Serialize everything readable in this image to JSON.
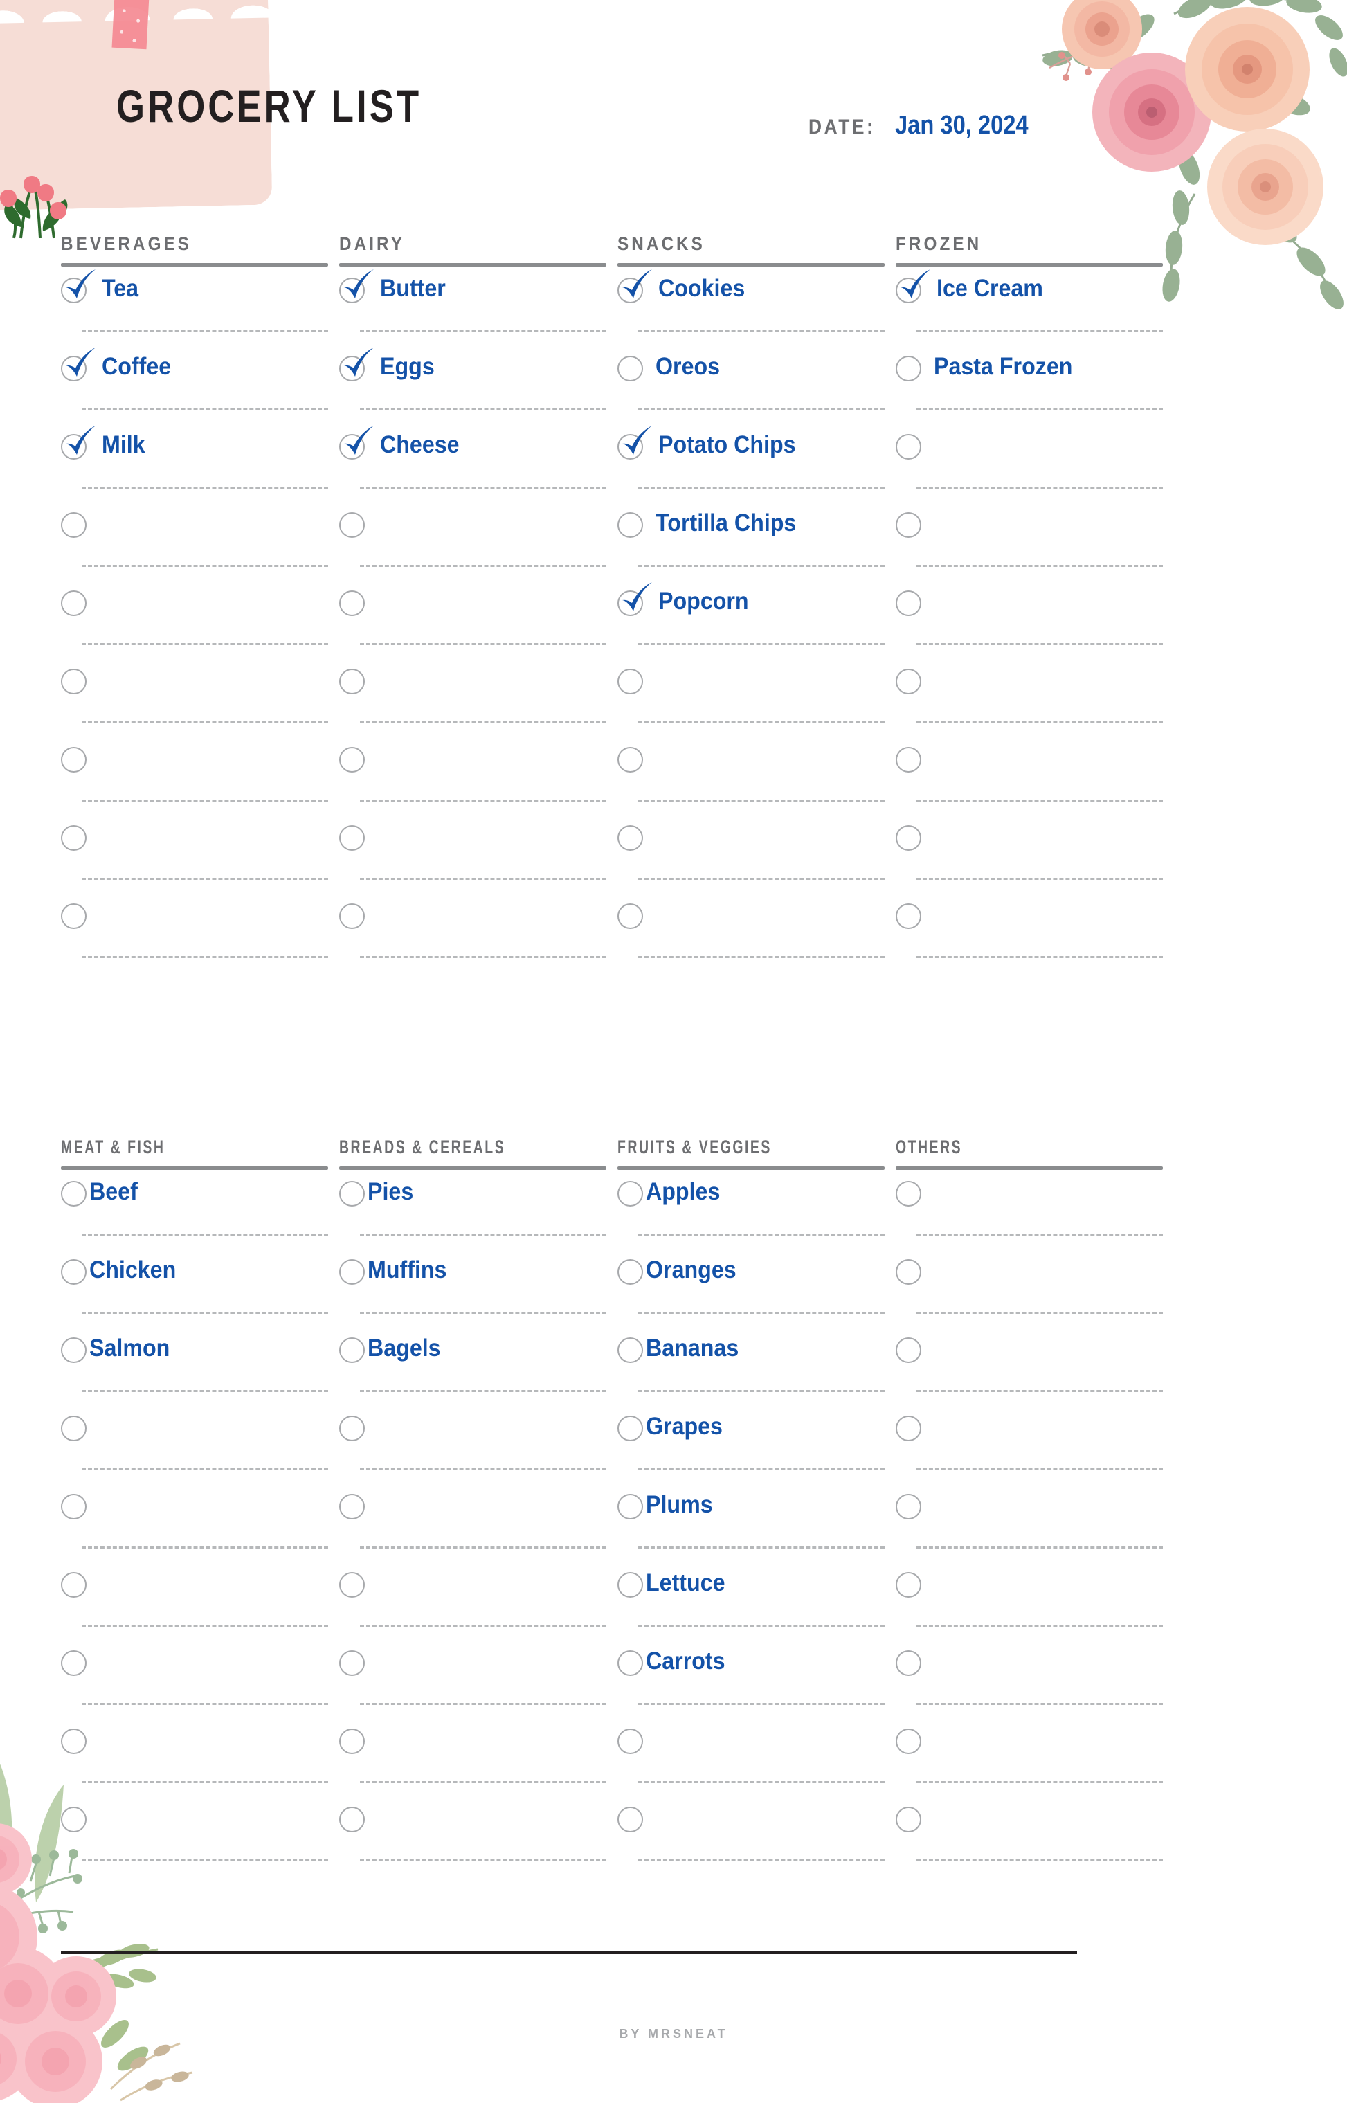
{
  "header": {
    "title": "GROCERY LIST",
    "date_label": "DATE:",
    "date_value": "Jan 30, 2024"
  },
  "colors": {
    "item_blue": "#1452a8",
    "header_gray": "#6d6e71",
    "rule_gray": "#8a8c8e",
    "dash_gray": "#b6b8ba",
    "title_black": "#231f20",
    "paper_pink": "#f6ddd6",
    "washi_pink": "#f58a93"
  },
  "decorations": [
    {
      "name": "torn-paper-patch",
      "position": "top-left"
    },
    {
      "name": "washi-tape",
      "position": "top-left"
    },
    {
      "name": "tulips-illustration",
      "position": "top-left"
    },
    {
      "name": "rose-bouquet-illustration",
      "position": "top-right"
    },
    {
      "name": "pink-floral-illustration",
      "position": "bottom-left"
    }
  ],
  "sections": [
    {
      "id": "beverages",
      "title": "BEVERAGES",
      "rows": 9,
      "items": [
        {
          "label": "Tea",
          "checked": true
        },
        {
          "label": "Coffee",
          "checked": true
        },
        {
          "label": "Milk",
          "checked": true
        },
        {
          "label": "",
          "checked": false
        },
        {
          "label": "",
          "checked": false
        },
        {
          "label": "",
          "checked": false
        },
        {
          "label": "",
          "checked": false
        },
        {
          "label": "",
          "checked": false
        },
        {
          "label": "",
          "checked": false
        }
      ]
    },
    {
      "id": "dairy",
      "title": "DAIRY",
      "rows": 9,
      "items": [
        {
          "label": "Butter",
          "checked": true
        },
        {
          "label": "Eggs",
          "checked": true
        },
        {
          "label": "Cheese",
          "checked": true
        },
        {
          "label": "",
          "checked": false
        },
        {
          "label": "",
          "checked": false
        },
        {
          "label": "",
          "checked": false
        },
        {
          "label": "",
          "checked": false
        },
        {
          "label": "",
          "checked": false
        },
        {
          "label": "",
          "checked": false
        }
      ]
    },
    {
      "id": "snacks",
      "title": "SNACKS",
      "rows": 9,
      "items": [
        {
          "label": "Cookies",
          "checked": true
        },
        {
          "label": "Oreos",
          "checked": false
        },
        {
          "label": "Potato Chips",
          "checked": true
        },
        {
          "label": "Tortilla Chips",
          "checked": false
        },
        {
          "label": "Popcorn",
          "checked": true
        },
        {
          "label": "",
          "checked": false
        },
        {
          "label": "",
          "checked": false
        },
        {
          "label": "",
          "checked": false
        },
        {
          "label": "",
          "checked": false
        }
      ]
    },
    {
      "id": "frozen",
      "title": "FROZEN",
      "rows": 9,
      "items": [
        {
          "label": "Ice Cream",
          "checked": true
        },
        {
          "label": "Pasta Frozen",
          "checked": false
        },
        {
          "label": "",
          "checked": false
        },
        {
          "label": "",
          "checked": false
        },
        {
          "label": "",
          "checked": false
        },
        {
          "label": "",
          "checked": false
        },
        {
          "label": "",
          "checked": false
        },
        {
          "label": "",
          "checked": false
        },
        {
          "label": "",
          "checked": false
        }
      ]
    },
    {
      "id": "meat-and-fish",
      "title": "MEAT & FISH",
      "rows": 9,
      "items": [
        {
          "label": "Beef",
          "checked": false
        },
        {
          "label": "Chicken",
          "checked": false
        },
        {
          "label": "Salmon",
          "checked": false
        },
        {
          "label": "",
          "checked": false
        },
        {
          "label": "",
          "checked": false
        },
        {
          "label": "",
          "checked": false
        },
        {
          "label": "",
          "checked": false
        },
        {
          "label": "",
          "checked": false
        },
        {
          "label": "",
          "checked": false
        }
      ]
    },
    {
      "id": "breads-and-cereals",
      "title": "BREADS & CEREALS",
      "rows": 9,
      "items": [
        {
          "label": "Pies",
          "checked": false
        },
        {
          "label": "Muffins",
          "checked": false
        },
        {
          "label": "Bagels",
          "checked": false
        },
        {
          "label": "",
          "checked": false
        },
        {
          "label": "",
          "checked": false
        },
        {
          "label": "",
          "checked": false
        },
        {
          "label": "",
          "checked": false
        },
        {
          "label": "",
          "checked": false
        },
        {
          "label": "",
          "checked": false
        }
      ]
    },
    {
      "id": "fruits-and-veggies",
      "title": "FRUITS & VEGGIES",
      "rows": 9,
      "items": [
        {
          "label": "Apples",
          "checked": false
        },
        {
          "label": "Oranges",
          "checked": false
        },
        {
          "label": "Bananas",
          "checked": false
        },
        {
          "label": "Grapes",
          "checked": false
        },
        {
          "label": "Plums",
          "checked": false
        },
        {
          "label": "Lettuce",
          "checked": false
        },
        {
          "label": "Carrots",
          "checked": false
        },
        {
          "label": "",
          "checked": false
        },
        {
          "label": "",
          "checked": false
        }
      ]
    },
    {
      "id": "others",
      "title": "OTHERS",
      "rows": 9,
      "items": [
        {
          "label": "",
          "checked": false
        },
        {
          "label": "",
          "checked": false
        },
        {
          "label": "",
          "checked": false
        },
        {
          "label": "",
          "checked": false
        },
        {
          "label": "",
          "checked": false
        },
        {
          "label": "",
          "checked": false
        },
        {
          "label": "",
          "checked": false
        },
        {
          "label": "",
          "checked": false
        },
        {
          "label": "",
          "checked": false
        }
      ]
    }
  ],
  "footer": {
    "credit": "BY MRSNEAT"
  }
}
